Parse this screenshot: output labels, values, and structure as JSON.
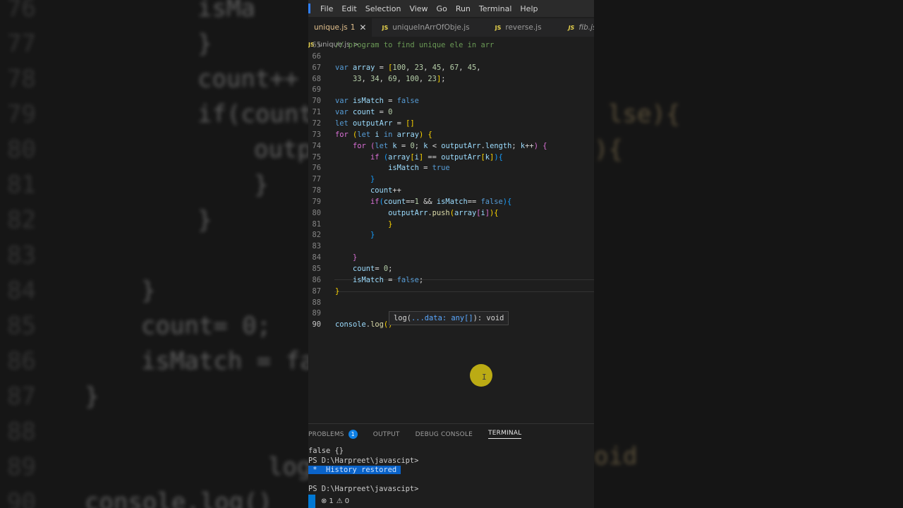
{
  "background": {
    "lines": [
      {
        "num": "76",
        "text": "isMa"
      },
      {
        "num": "77",
        "text": "}"
      },
      {
        "num": "78",
        "text": "count++"
      },
      {
        "num": "79",
        "text": "if(count"
      },
      {
        "num": "80",
        "text": "outp"
      },
      {
        "num": "81",
        "text": "}"
      },
      {
        "num": "82",
        "text": "}"
      },
      {
        "num": "83",
        "text": ""
      },
      {
        "num": "84",
        "text": "}"
      },
      {
        "num": "85",
        "text": "count= 0;"
      },
      {
        "num": "86",
        "text": "isMatch = fa"
      },
      {
        "num": "87",
        "text": "}"
      },
      {
        "num": "88",
        "text": ""
      },
      {
        "num": "89",
        "text": "log"
      },
      {
        "num": "90",
        "text": "console.log()"
      }
    ],
    "right_fragments": [
      "lse){",
      "){",
      "oid"
    ]
  },
  "menubar": {
    "items": [
      "File",
      "Edit",
      "Selection",
      "View",
      "Go",
      "Run",
      "Terminal",
      "Help"
    ]
  },
  "tabs": [
    {
      "label": "unique.js",
      "badge": "1",
      "active": true
    },
    {
      "label": "uniqueInArrOfObje.js",
      "active": false
    },
    {
      "label": "reverse.js",
      "active": false
    },
    {
      "label": "fib.js",
      "active": false
    }
  ],
  "tab_close_glyph": "✕",
  "js_icon_label": "JS",
  "breadcrumb": {
    "file": "unique.js",
    "sep": ">",
    "rest": "..."
  },
  "code": {
    "line_numbers": [
      "65",
      "66",
      "67",
      "68",
      "69",
      "70",
      "71",
      "72",
      "73",
      "74",
      "75",
      "76",
      "77",
      "78",
      "79",
      "80",
      "81",
      "82",
      "83",
      "84",
      "85",
      "86",
      "87",
      "88",
      "89",
      "90"
    ],
    "current_line": "90"
  },
  "hover_hint": {
    "prefix": "log(",
    "params": "...data: any[]",
    "suffix": "): void"
  },
  "panel": {
    "tabs": [
      "PROBLEMS",
      "OUTPUT",
      "DEBUG CONSOLE",
      "TERMINAL"
    ],
    "problems_count": "1",
    "active_tab": "TERMINAL",
    "terminal_lines": [
      "false {}",
      "PS D:\\Harpreet\\javascipt>",
      " *  History restored ",
      "",
      "PS D:\\Harpreet\\javascipt>"
    ]
  },
  "statusbar": {
    "errors": "1",
    "warnings": "0"
  },
  "colors": {
    "accent": "#0078d4",
    "cursor_highlight": "#c9b714",
    "keyword": "#569cd6"
  }
}
